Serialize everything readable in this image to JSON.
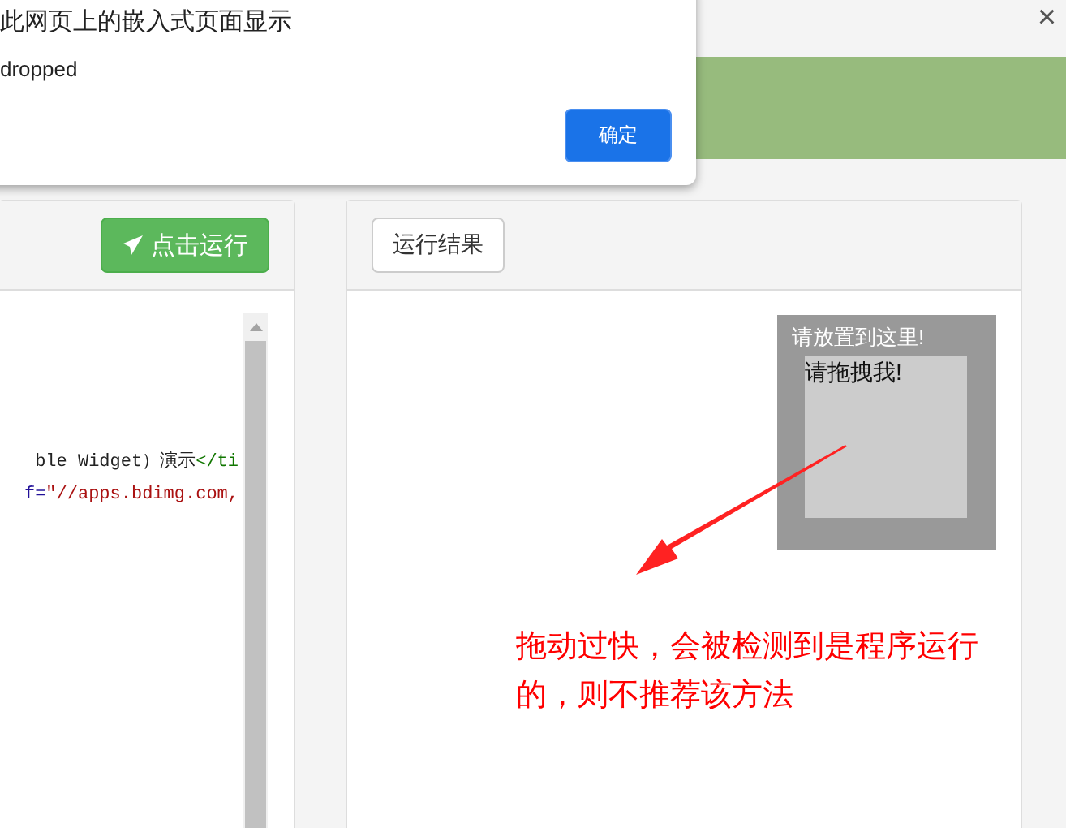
{
  "close_label": "×",
  "dialog": {
    "title": "此网页上的嵌入式页面显示",
    "message": "dropped",
    "ok_button": "确定"
  },
  "code_panel": {
    "run_button": "点击运行",
    "code_lines": [
      {
        "tokens": [
          {
            "text": "ble Widget）演示",
            "kind": "plain"
          },
          {
            "text": "</ti",
            "kind": "tag"
          }
        ]
      },
      {
        "tokens": [
          {
            "text": "f=",
            "kind": "attr"
          },
          {
            "text": "\"//apps.bdimg.com,",
            "kind": "string"
          }
        ]
      }
    ]
  },
  "result_panel": {
    "tab": "运行结果",
    "drop_target": "请放置到这里!",
    "drag_box": "请拖拽我!",
    "note": "拖动过快，会被检测到是程序运行的，则不推荐该方法"
  }
}
